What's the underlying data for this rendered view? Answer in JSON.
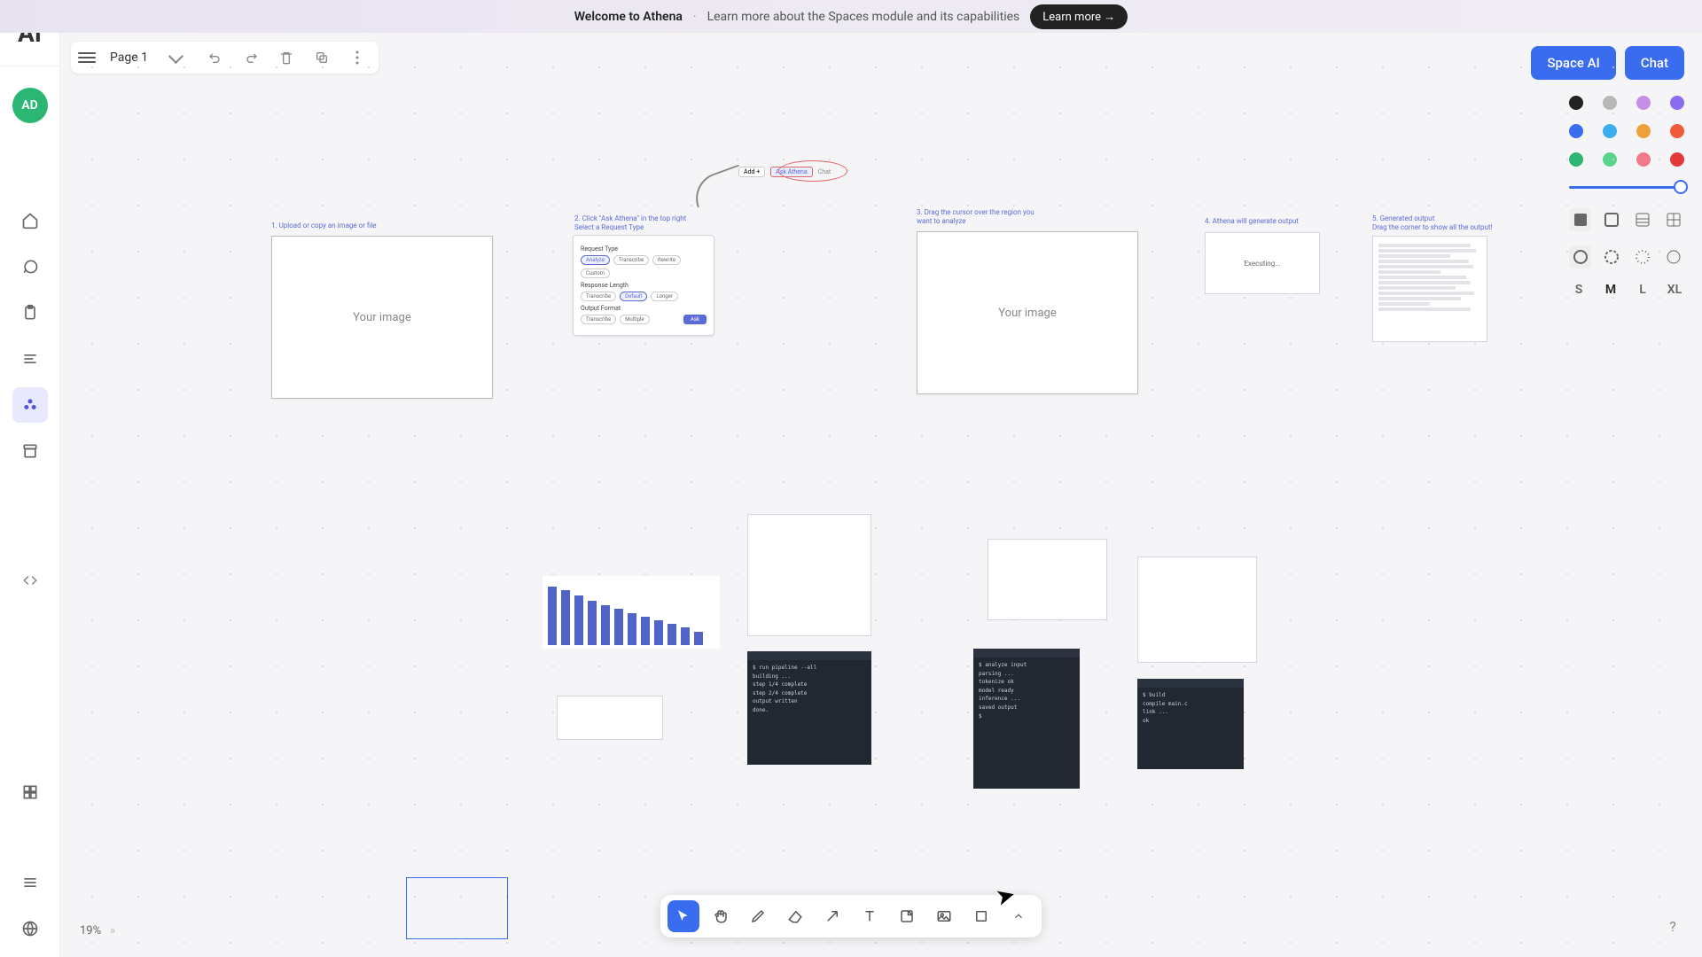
{
  "banner": {
    "title": "Welcome to Athena",
    "desc": "Learn more about the Spaces module and its capabilities",
    "cta": "Learn more →"
  },
  "logo": "AI",
  "topbar": {
    "page_label": "Page 1"
  },
  "avatar": "AD",
  "top_right": {
    "space_ai": "Space AI",
    "chat": "Chat"
  },
  "colors": {
    "row1": [
      "#222222",
      "#b8b8b8",
      "#c78ee8",
      "#8a6cf0"
    ],
    "row2": [
      "#3a6cf0",
      "#3aaef0",
      "#f0a23a",
      "#f05a3a"
    ],
    "row3": [
      "#2bb673",
      "#5ad68c",
      "#f07a8a",
      "#e23a3a"
    ]
  },
  "sizes": [
    "S",
    "M",
    "L",
    "XL"
  ],
  "steps": {
    "s1": "1. Upload or copy an image or file",
    "s2a": "2. Click \"Ask Athena\" in the top right",
    "s2b": "Select a Request Type",
    "s3a": "3. Drag the cursor over the region you",
    "s3b": "want to analyze",
    "s4": "4. Athena will generate output",
    "s5a": "5. Generated output",
    "s5b": "Drag the corner to show all the output!"
  },
  "placeholders": {
    "your_image": "Your image",
    "executing": "Executing..."
  },
  "mini_top": {
    "add": "Add +",
    "ask": "Ask Athena",
    "chat": "Chat"
  },
  "prompt": {
    "request_type": "Request Type",
    "rt": [
      "Analyze",
      "Transcribe",
      "Rewrite",
      "Custom"
    ],
    "response_length": "Response Length",
    "rl": [
      "Transcribe",
      "Default",
      "Longer"
    ],
    "output_format": "Output Format",
    "of": [
      "Transcribe",
      "Multiple"
    ],
    "ask": "Ask"
  },
  "zoom": "19%",
  "chart_data": {
    "type": "bar",
    "values": [
      95,
      88,
      80,
      72,
      64,
      58,
      52,
      46,
      40,
      34,
      28,
      22
    ],
    "ylim": [
      0,
      100
    ]
  }
}
